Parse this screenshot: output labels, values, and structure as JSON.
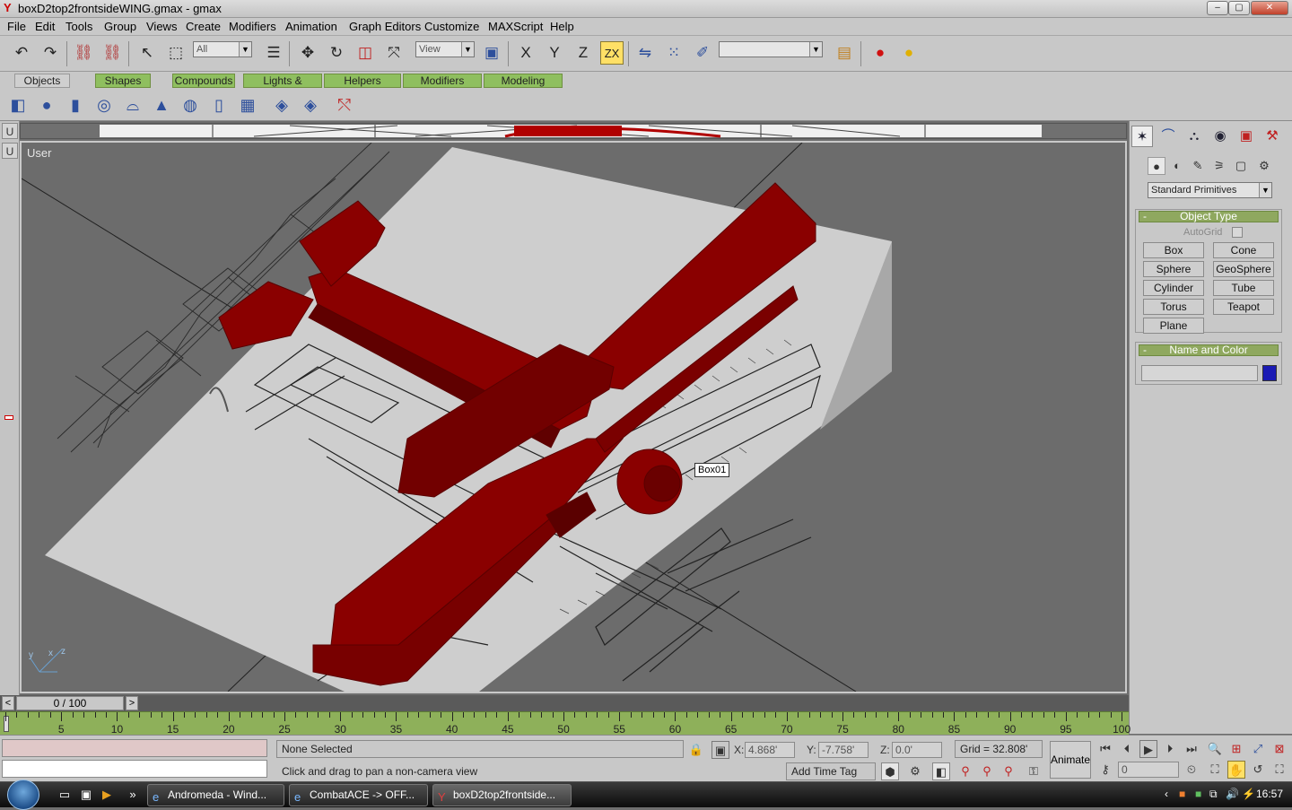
{
  "window": {
    "title": "boxD2top2frontsideWING.gmax - gmax",
    "minimize": "‒",
    "maximize": "▢",
    "close": "✕"
  },
  "menu": [
    "File",
    "Edit",
    "Tools",
    "Group",
    "Views",
    "Create",
    "Modifiers",
    "Animation",
    "Graph Editors",
    "Customize",
    "MAXScript",
    "Help"
  ],
  "toolbar": {
    "selection_filter": "All",
    "reference_coord": "View",
    "named_selection": "",
    "axis_x": "X",
    "axis_y": "Y",
    "axis_z": "Z",
    "axis_xy": "ZX"
  },
  "tabs": [
    "Objects",
    "Shapes",
    "Compounds",
    "Lights & Cameras",
    "Helpers",
    "Modifiers",
    "Modeling"
  ],
  "active_tab": "Objects",
  "viewport": {
    "label": "User",
    "tooltip": "Box01",
    "side_label": "U",
    "side_label_2": "U",
    "axis_x": "x",
    "axis_y": "y",
    "axis_z": "z"
  },
  "command_panel": {
    "category": "Standard Primitives",
    "object_type_title": "Object Type",
    "autogrid_label": "AutoGrid",
    "buttons": [
      "Box",
      "Cone",
      "Sphere",
      "GeoSphere",
      "Cylinder",
      "Tube",
      "Torus",
      "Teapot",
      "Plane"
    ],
    "name_color_title": "Name and Color",
    "name_value": "",
    "color": "#1b1bb4"
  },
  "timeline": {
    "position_label": "0 / 100",
    "prev": "<",
    "next": ">",
    "ticks": [
      "5",
      "10",
      "15",
      "20",
      "25",
      "30",
      "35",
      "40",
      "45",
      "50",
      "55",
      "60",
      "65",
      "70",
      "75",
      "80",
      "85",
      "90",
      "95",
      "100"
    ]
  },
  "status": {
    "selection": "None Selected",
    "prompt": "Click and drag to pan a non-camera view",
    "x_label": "X:",
    "x_value": "4.868'",
    "y_label": "Y:",
    "y_value": "-7.758'",
    "z_label": "Z:",
    "z_value": "0.0'",
    "grid": "Grid = 32.808'",
    "add_time_tag": "Add Time Tag",
    "animate": "Animate",
    "frame_value": "0"
  },
  "taskbar": {
    "tasks": [
      "Andromeda - Wind...",
      "CombatACE -> OFF...",
      "boxD2top2frontside..."
    ],
    "clock": "16:57"
  },
  "colors": {
    "aircraft": "#8a0000",
    "tab_green": "#8fbf5f",
    "track_green": "#8eb05a"
  }
}
